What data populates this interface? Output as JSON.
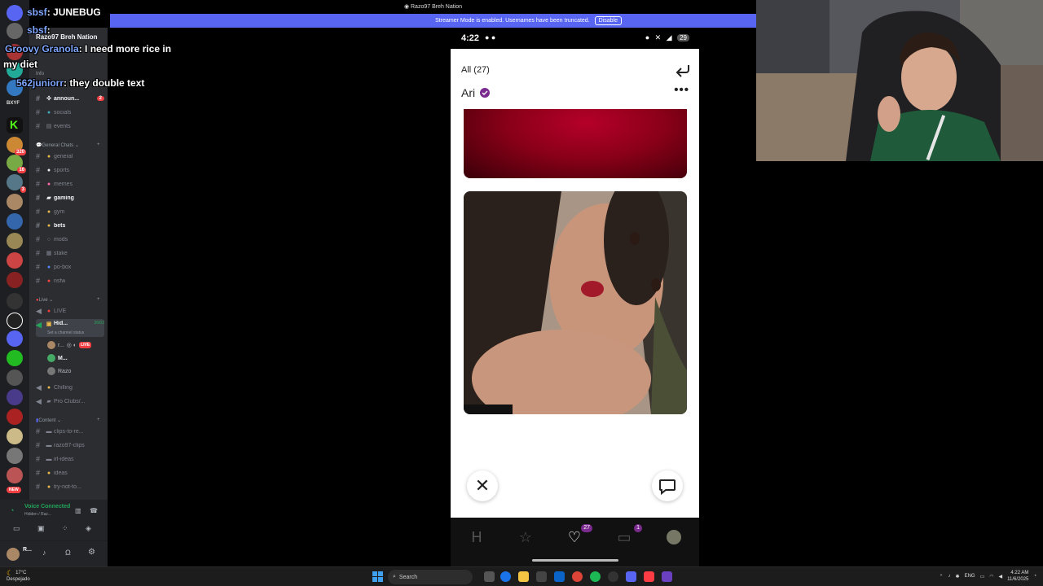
{
  "chat": {
    "lines": [
      {
        "user": "sbsf",
        "text": ": JUNEBUG"
      },
      {
        "user": "sbsf",
        "text": ":"
      },
      {
        "user": "Groovy Granola",
        "text": ": I need more rice in"
      },
      {
        "user": "",
        "text": "my diet"
      },
      {
        "user": "562juniorr",
        "text": ": they double text"
      }
    ]
  },
  "window_title": "Razo97 Breh Nation",
  "streamer_banner": {
    "text": "Streamer Mode is enabled. Usernames have been truncated.",
    "button": "Disable"
  },
  "discord": {
    "server_name": "Razo97 Breh Nation",
    "categories": {
      "info": "Info",
      "general": "General Chats",
      "live": "Live",
      "content": "Content"
    },
    "channels": {
      "announcements": "announ...",
      "announcements_badge": "2",
      "socials": "socials",
      "events": "events",
      "general": "general",
      "sports": "sports",
      "memes": "memes",
      "gaming": "gaming",
      "gym": "gym",
      "bets": "bets",
      "mods": "mods",
      "stake": "stake",
      "pobox": "po-box",
      "nsfw": "nsfw",
      "live": "LIVE",
      "hidden": "Hid...",
      "hidden_count": "26/02",
      "hidden_status": "Set a channel status",
      "chilling": "Chilling",
      "proclubs": "Pro Clubs/...",
      "clips": "clips-to-re...",
      "razoclips": "razo97-clips",
      "irl": "irl-ideas",
      "ideas": "ideas",
      "trynot": "try-not-to..."
    },
    "voice_users": [
      {
        "name": "r...",
        "live": "LIVE"
      },
      {
        "name": "M..."
      },
      {
        "name": "Razo"
      }
    ],
    "voice": {
      "status": "Voice Connected",
      "channel": "Hidden / Raz..."
    },
    "user": "R...",
    "server_badges": {
      "new": "NEW",
      "m1": "320",
      "m2": "16",
      "m3": "3"
    },
    "rail_label": "BXYF"
  },
  "phone": {
    "time": "4:22",
    "battery": "29",
    "all_count": "All (27)",
    "profile_name": "Ari",
    "nav": {
      "likes_badge": "27",
      "messages_badge": "1"
    }
  },
  "taskbar": {
    "weather_temp": "17°C",
    "weather_desc": "Despejado",
    "search": "Search",
    "lang": "ENG",
    "time": "4:22 AM",
    "date": "11/6/2025"
  },
  "colors": {
    "discord_accent": "#5865f2",
    "live_red": "#f23f43",
    "hinge_purple": "#7b2b8f"
  }
}
